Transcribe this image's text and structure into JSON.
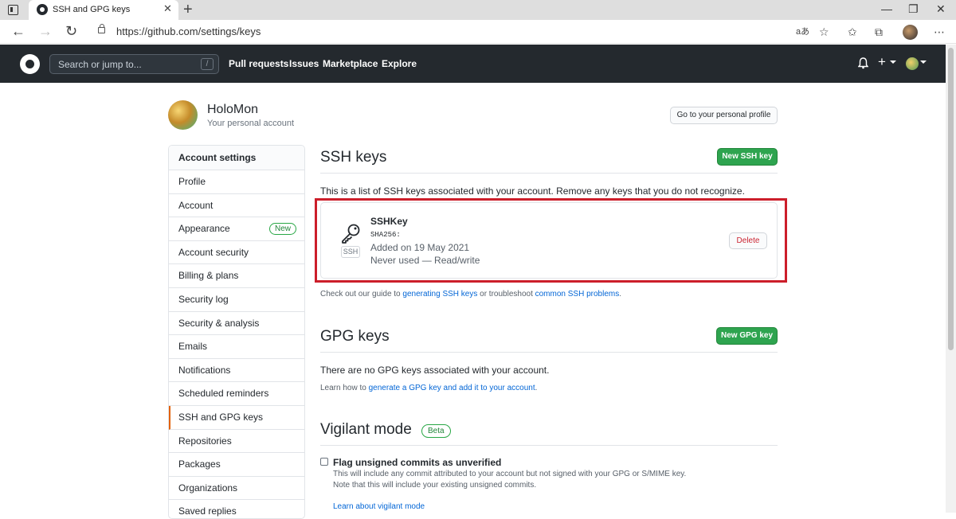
{
  "browser": {
    "tab_title": "SSH and GPG keys",
    "tab_close": "✕",
    "new_tab": "+",
    "url": "https://github.com/settings/keys",
    "window_controls": [
      "—",
      "❐",
      "✕"
    ]
  },
  "header": {
    "search_placeholder": "Search or jump to...",
    "search_shortcut": "/",
    "nav": [
      "Pull requests",
      "Issues",
      "Marketplace",
      "Explore"
    ],
    "plus": "+",
    "bell": "🔔"
  },
  "profile": {
    "name": "HoloMon",
    "subtitle": "Your personal account",
    "profile_button": "Go to your personal profile"
  },
  "sidebar": {
    "heading": "Account settings",
    "items": [
      {
        "label": "Profile"
      },
      {
        "label": "Account"
      },
      {
        "label": "Appearance",
        "badge": "New"
      },
      {
        "label": "Account security"
      },
      {
        "label": "Billing & plans"
      },
      {
        "label": "Security log"
      },
      {
        "label": "Security & analysis"
      },
      {
        "label": "Emails"
      },
      {
        "label": "Notifications"
      },
      {
        "label": "Scheduled reminders"
      },
      {
        "label": "SSH and GPG keys",
        "active": true
      },
      {
        "label": "Repositories"
      },
      {
        "label": "Packages"
      },
      {
        "label": "Organizations"
      },
      {
        "label": "Saved replies"
      }
    ]
  },
  "ssh": {
    "title": "SSH keys",
    "new_button": "New SSH key",
    "description": "This is a list of SSH keys associated with your account. Remove any keys that you do not recognize.",
    "key": {
      "name": "SSHKey",
      "fingerprint": "SHA256:",
      "type_label": "SSH",
      "added": "Added on 19 May 2021",
      "usage": "Never used — Read/write",
      "delete_button": "Delete"
    },
    "help_prefix": "Check out our guide to ",
    "help_link1": "generating SSH keys",
    "help_middle": " or troubleshoot ",
    "help_link2": "common SSH problems",
    "help_suffix": "."
  },
  "gpg": {
    "title": "GPG keys",
    "new_button": "New GPG key",
    "empty_text": "There are no GPG keys associated with your account.",
    "help_prefix": "Learn how to ",
    "help_link": "generate a GPG key and add it to your account",
    "help_suffix": "."
  },
  "vigilant": {
    "title": "Vigilant mode",
    "badge": "Beta",
    "checkbox_label": "Flag unsigned commits as unverified",
    "desc1": "This will include any commit attributed to your account but not signed with your GPG or S/MIME key.",
    "desc2": "Note that this will include your existing unsigned commits.",
    "learn_link": "Learn about vigilant mode"
  }
}
